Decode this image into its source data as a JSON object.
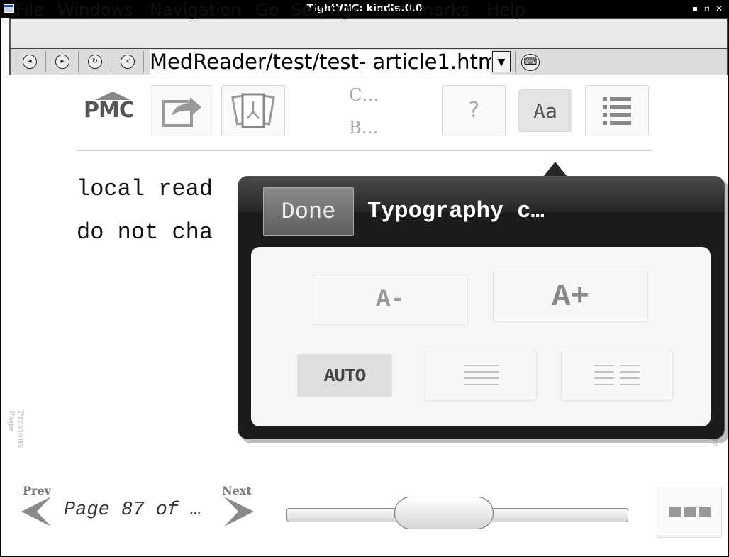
{
  "window": {
    "title": "TightVNC: kindle:0.0",
    "controls": [
      "▪",
      "▫",
      "✕"
    ]
  },
  "menubar": {
    "items": [
      "File",
      "Windows",
      "Navigation",
      "Go",
      "Settings",
      "Bookmarks",
      "Help"
    ]
  },
  "browser_toolbar": {
    "url": "MedReader/test/test- article1.html",
    "dropdown_glyph": "▼"
  },
  "reader_toolbar": {
    "logo": "PMC",
    "label_top": "C…",
    "label_bottom": "B…",
    "help_label": "?",
    "font_label": "Aa"
  },
  "article": {
    "line1": "local read",
    "line2": "do not cha"
  },
  "side_labels": {
    "prev": "Previous Page",
    "next": "age"
  },
  "pager": {
    "prev_label": "Prev",
    "next_label": "Next",
    "page_text": "Page 87 of …",
    "slider_value": 0.46
  },
  "popover": {
    "done_label": "Done",
    "title": "Typography c…",
    "decrease_label": "A-",
    "increase_label": "A+",
    "auto_label": "AUTO"
  }
}
